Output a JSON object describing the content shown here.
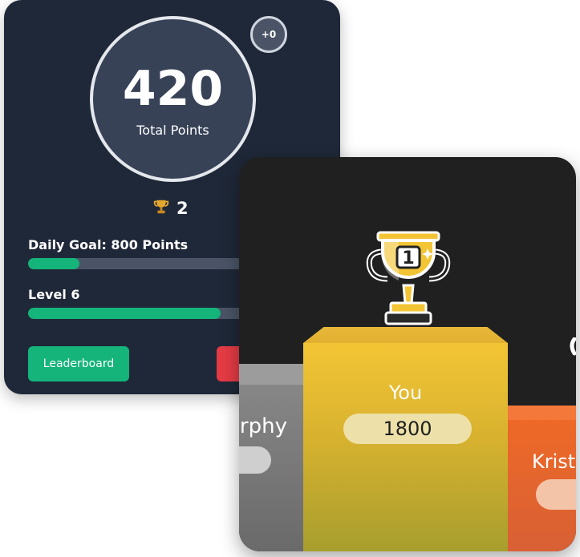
{
  "points_card": {
    "points": "420",
    "points_label": "Total Points",
    "delta": "+0",
    "trophy_count": "2",
    "daily_goal_label": "Daily Goal: 800 Points",
    "daily_goal_progress": 0.16,
    "level_label": "Level 6",
    "level_progress": 0.6,
    "leaderboard_button": "Leaderboard"
  },
  "podium": {
    "first": {
      "rank": "1",
      "name": "You",
      "score": "1800"
    },
    "second_name": "urphy",
    "third_name": "Krist"
  },
  "colors": {
    "card_bg": "#1f2838",
    "accent_green": "#14b47a",
    "danger_red": "#e53b45",
    "gold": "#f3c535",
    "bronze": "#f06a25"
  }
}
